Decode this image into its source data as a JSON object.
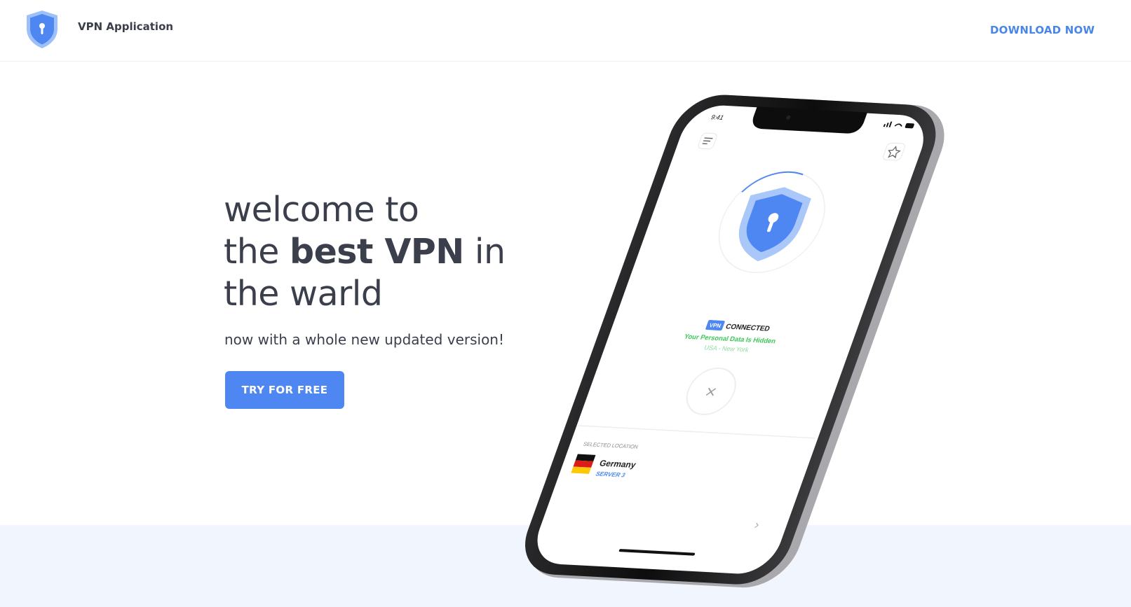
{
  "header": {
    "brand": "VPN Application",
    "download_label": "DOWNLOAD NOW"
  },
  "hero": {
    "line1": "welcome to",
    "line2_pre": "the ",
    "line2_bold": "best VPN",
    "line2_post": " in",
    "line3": "the warld",
    "subtitle": "now with a whole new updated version!",
    "cta_label": "TRY FOR FREE"
  },
  "phone": {
    "time": "9:41",
    "vpn_tag": "VPN",
    "status": "CONNECTED",
    "hidden_text": "Your Personal Data Is Hidden",
    "location_text": "USA - New York",
    "disconnect_glyph": "×",
    "selected_label": "SELECTED LOCATION",
    "country": "Germany",
    "server": "SERVER 3",
    "next_glyph": "›"
  },
  "colors": {
    "accent": "#4f87f2",
    "link": "#4a86e8",
    "connected_green": "#3ec75a",
    "band": "#f1f5fd"
  },
  "icons": [
    "shield-lock-icon",
    "menu-icon",
    "star-icon",
    "close-icon",
    "germany-flag-icon",
    "chevron-right-icon"
  ]
}
